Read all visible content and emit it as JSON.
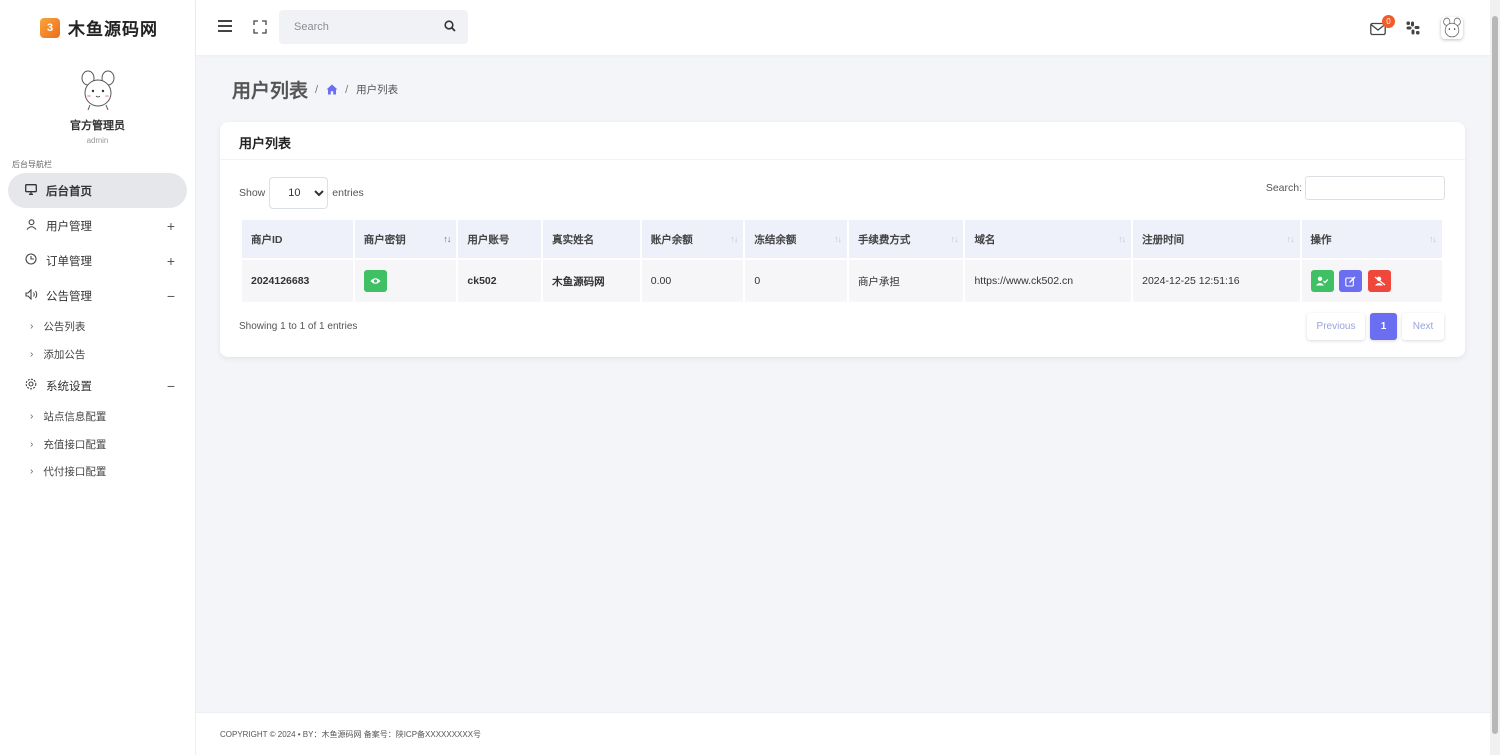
{
  "brand": {
    "logo_text": "3",
    "name": "木鱼源码网"
  },
  "profile": {
    "name": "官方管理员",
    "role": "admin"
  },
  "sidebar": {
    "section_title": "后台导航栏",
    "items": [
      {
        "label": "后台首页",
        "icon": "monitor-icon",
        "active": true,
        "toggle": ""
      },
      {
        "label": "用户管理",
        "icon": "user-icon",
        "toggle": "+"
      },
      {
        "label": "订单管理",
        "icon": "clock-icon",
        "toggle": "+"
      },
      {
        "label": "公告管理",
        "icon": "speaker-icon",
        "toggle": "−",
        "sub": [
          "公告列表",
          "添加公告"
        ]
      },
      {
        "label": "系统设置",
        "icon": "gear-icon",
        "toggle": "−",
        "sub": [
          "站点信息配置",
          "充值接口配置",
          "代付接口配置"
        ]
      }
    ]
  },
  "topbar": {
    "search_placeholder": "Search",
    "mail_count": "0"
  },
  "page": {
    "title": "用户列表",
    "sep1": "/",
    "sep2": "/",
    "crumb": "用户列表"
  },
  "card": {
    "title": "用户列表",
    "show_label": "Show",
    "entries_label": "entries",
    "page_length": "10",
    "page_length_options": [
      "10"
    ],
    "search_label": "Search:",
    "columns": [
      "商户ID",
      "商户密钥",
      "用户账号",
      "真实姓名",
      "账户余额",
      "冻结余额",
      "手续费方式",
      "域名",
      "注册时间",
      "操作"
    ],
    "rows": [
      {
        "id": "2024126683",
        "account": "ck502",
        "name": "木鱼源码网",
        "balance": "0.00",
        "frozen": "0",
        "fee_mode": "商户承担",
        "domain": "https://www.ck502.cn",
        "registered": "2024-12-25 12:51:16"
      }
    ],
    "info": "Showing 1 to 1 of 1 entries",
    "pager": {
      "prev": "Previous",
      "current": "1",
      "next": "Next"
    }
  },
  "footer": {
    "text": "COPYRIGHT © 2024 • BY：木鱼源码网    备案号：陕ICP备XXXXXXXXX号"
  },
  "colors": {
    "accent": "#6c6ef2",
    "success": "#3fc064",
    "danger": "#f0473c",
    "badge": "#f25c2a"
  }
}
